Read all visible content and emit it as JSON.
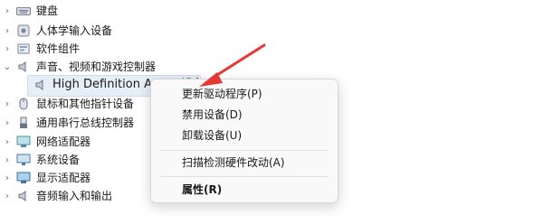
{
  "tree": {
    "items": [
      {
        "label": "键盘",
        "icon": "keyboard-icon"
      },
      {
        "label": "人体学输入设备",
        "icon": "hid-icon"
      },
      {
        "label": "软件组件",
        "icon": "software-component-icon"
      },
      {
        "label": "声音、视频和游戏控制器",
        "icon": "speaker-icon"
      },
      {
        "label": "High Definition Audio 设备",
        "icon": "speaker-icon"
      },
      {
        "label": "鼠标和其他指针设备",
        "icon": "mouse-icon"
      },
      {
        "label": "通用串行总线控制器",
        "icon": "usb-icon"
      },
      {
        "label": "网络适配器",
        "icon": "network-adapter-icon"
      },
      {
        "label": "系统设备",
        "icon": "system-device-icon"
      },
      {
        "label": "显示适配器",
        "icon": "display-adapter-icon"
      },
      {
        "label": "音频输入和输出",
        "icon": "speaker-icon"
      }
    ]
  },
  "context_menu": {
    "items": [
      {
        "label": "更新驱动程序(P)"
      },
      {
        "label": "禁用设备(D)"
      },
      {
        "label": "卸载设备(U)"
      },
      {
        "label": "扫描检测硬件改动(A)"
      },
      {
        "label": "属性(R)"
      }
    ]
  },
  "colors": {
    "arrow": "#e53935",
    "selection": "#e6eef8"
  }
}
